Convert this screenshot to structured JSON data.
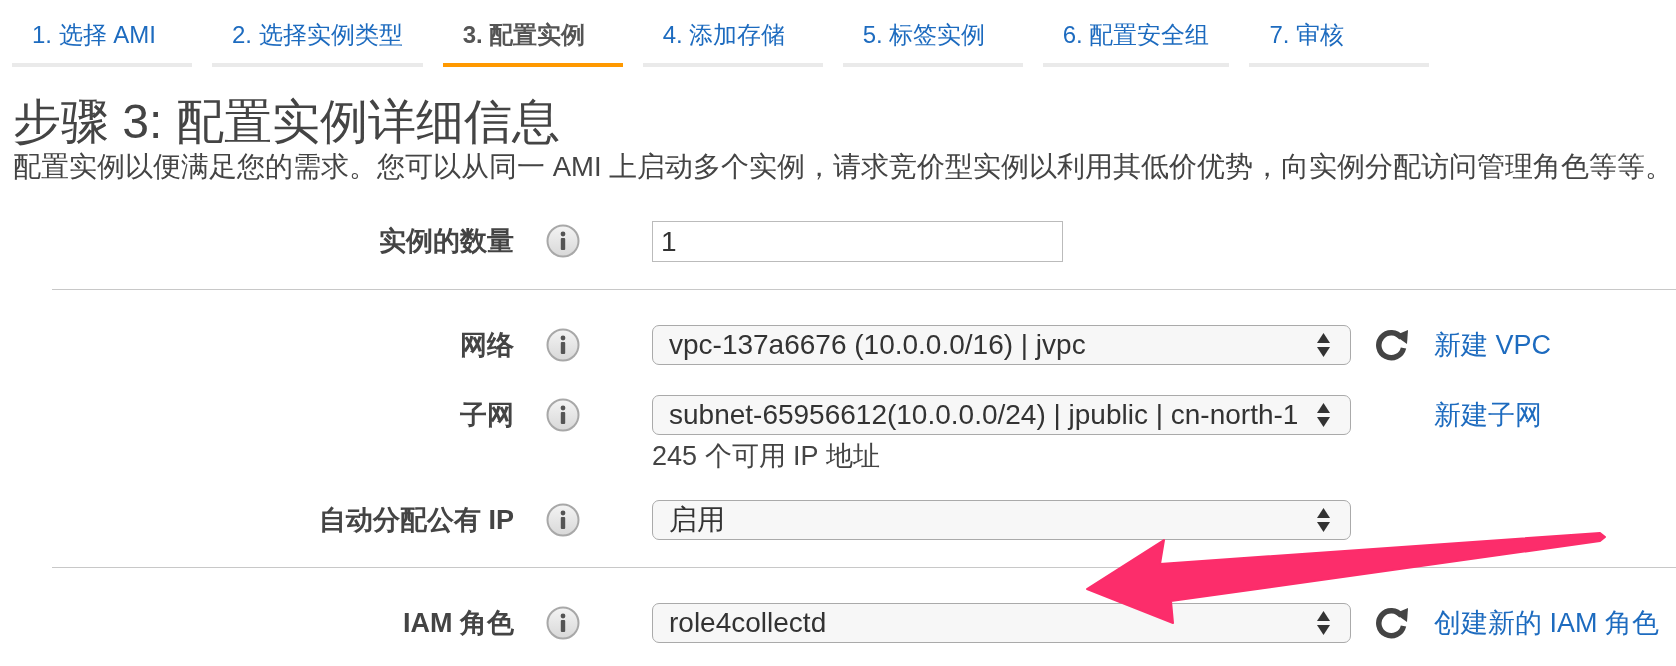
{
  "tabs": [
    {
      "label": "1. 选择 AMI",
      "selected": false
    },
    {
      "label": "2. 选择实例类型",
      "selected": false
    },
    {
      "label": "3. 配置实例",
      "selected": true
    },
    {
      "label": "4. 添加存储",
      "selected": false
    },
    {
      "label": "5. 标签实例",
      "selected": false
    },
    {
      "label": "6. 配置安全组",
      "selected": false
    },
    {
      "label": "7. 审核",
      "selected": false
    }
  ],
  "heading": "步骤 3: 配置实例详细信息",
  "description": "配置实例以便满足您的需求。您可以从同一 AMI 上启动多个实例，请求竞价型实例以利用其低价优势，向实例分配访问管理角色等等。",
  "form": {
    "sections": [
      {
        "fields": [
          {
            "label": "实例的数量",
            "kind": "text",
            "value": "1"
          }
        ]
      },
      {
        "fields": [
          {
            "label": "网络",
            "kind": "select",
            "value": "vpc-137a6676 (10.0.0.0/16) | jvpc",
            "refresh_button": true,
            "link": "新建 VPC"
          },
          {
            "label": "子网",
            "kind": "select",
            "value": "subnet-65956612(10.0.0.0/24) | jpublic | cn-north-1",
            "refresh_button": false,
            "link": "新建子网",
            "note": "245 个可用 IP 地址"
          },
          {
            "label": "自动分配公有 IP",
            "kind": "select",
            "value": "启用"
          }
        ]
      },
      {
        "fields": [
          {
            "label": "IAM 角色",
            "kind": "select",
            "value": "role4collectd",
            "refresh_button": true,
            "link": "创建新的 IAM 角色"
          }
        ]
      }
    ]
  }
}
